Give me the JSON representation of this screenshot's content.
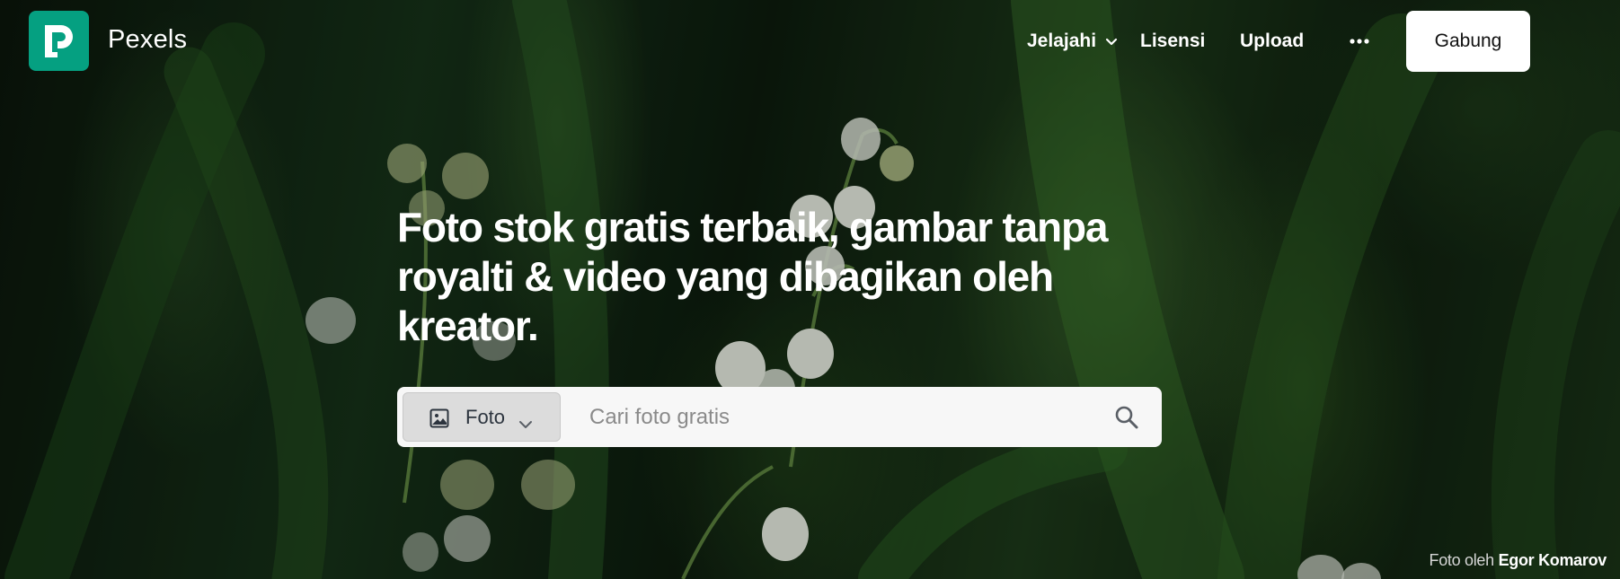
{
  "brand": {
    "name": "Pexels"
  },
  "nav": {
    "explore": "Jelajahi",
    "license": "Lisensi",
    "upload": "Upload",
    "join": "Gabung"
  },
  "hero": {
    "headline": "Foto stok gratis terbaik, gambar tanpa royalti & video yang dibagikan oleh kreator."
  },
  "search": {
    "media_type": "Foto",
    "placeholder": "Cari foto gratis"
  },
  "credit": {
    "prefix": "Foto oleh",
    "author": "Egor Komarov"
  },
  "colors": {
    "brand": "#05a081",
    "button_bg": "#ffffff",
    "search_bg": "#f7f7f7"
  },
  "icons": [
    "pexels-logo-icon",
    "chevron-down-icon",
    "more-dots-icon",
    "image-icon",
    "search-icon"
  ]
}
